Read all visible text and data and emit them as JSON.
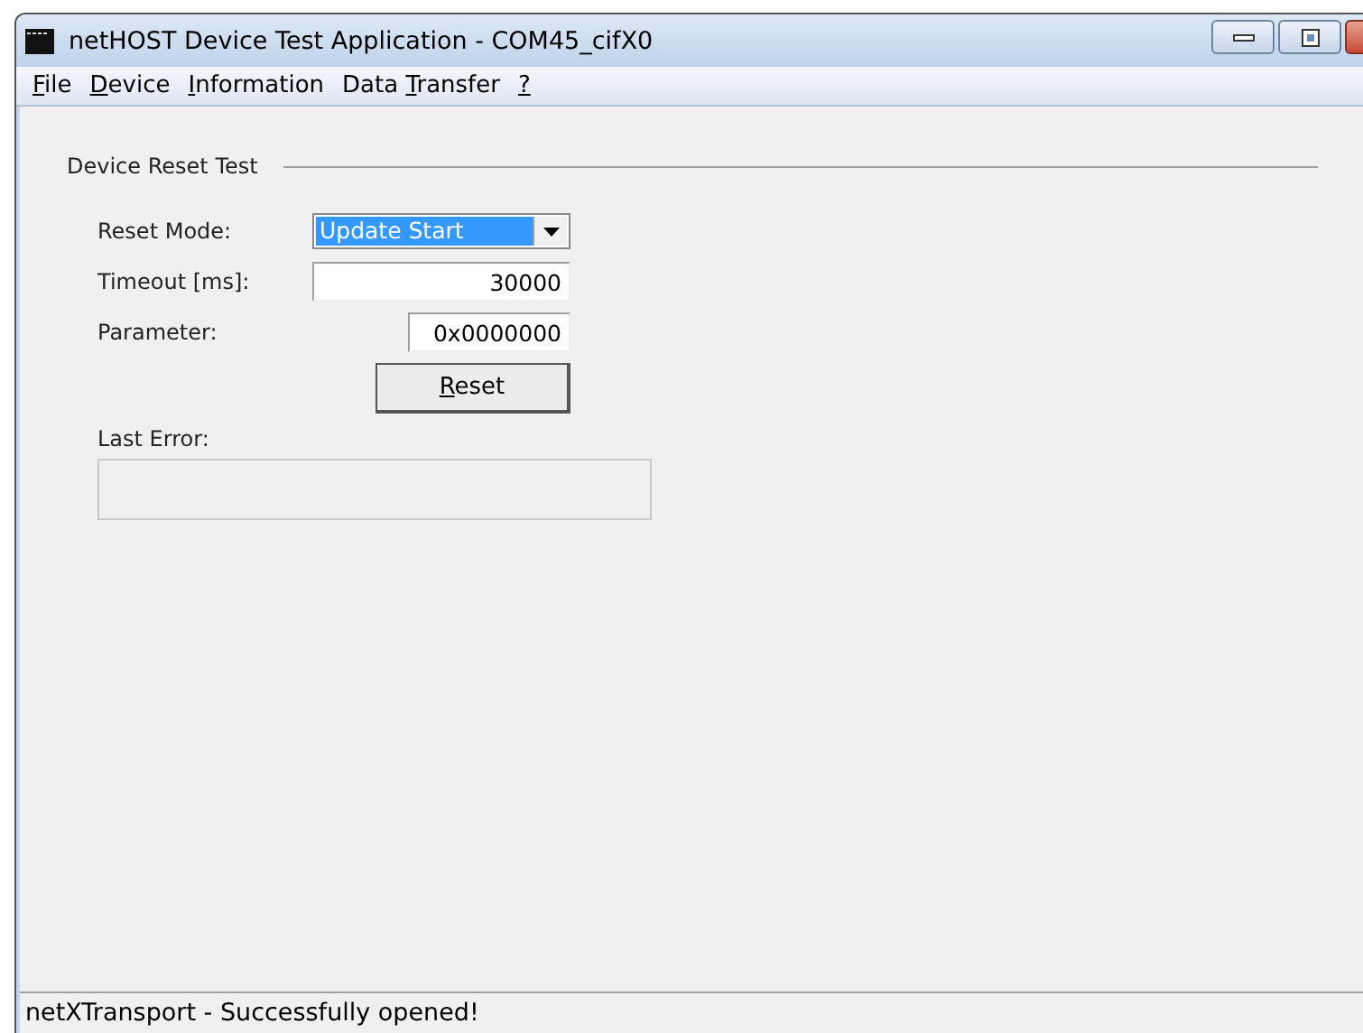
{
  "window": {
    "title": "netHOST Device Test Application - COM45_cifX0"
  },
  "menu": [
    {
      "key": "F",
      "post": "ile"
    },
    {
      "key": "D",
      "post": "evice"
    },
    {
      "key": "I",
      "post": "nformation"
    },
    {
      "pre": "Data ",
      "key": "T",
      "post": "ransfer"
    },
    {
      "key": "?"
    }
  ],
  "group": {
    "title": "Device Reset Test",
    "reset_mode": {
      "label": "Reset Mode:",
      "value": "Update Start"
    },
    "timeout": {
      "label": "Timeout [ms]:",
      "value": "30000"
    },
    "parameter": {
      "label": "Parameter:",
      "value": "0x0000000"
    },
    "reset_button": {
      "key": "R",
      "post": "eset"
    },
    "last_error": {
      "label": "Last Error:"
    }
  },
  "status_bar": "netXTransport - Successfully opened!"
}
